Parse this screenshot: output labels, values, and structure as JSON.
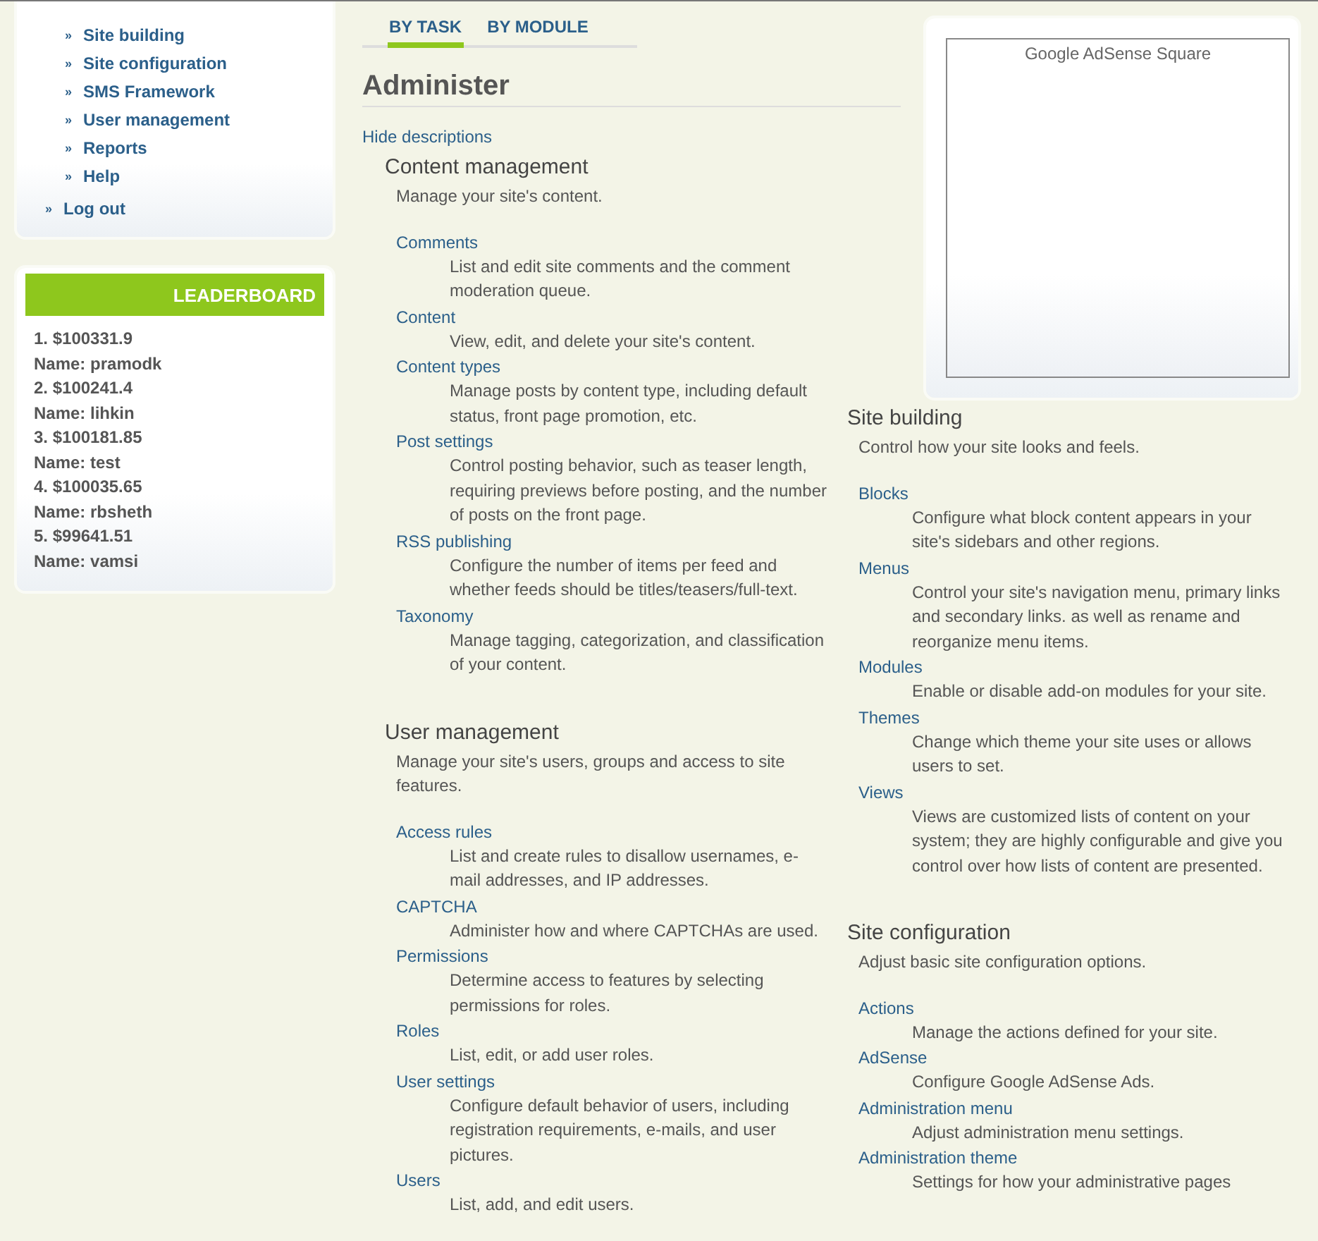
{
  "sidebar": {
    "nav_items": [
      {
        "marker": "»",
        "label": "Site building"
      },
      {
        "marker": "»",
        "label": "Site configuration"
      },
      {
        "marker": "»",
        "label": "SMS Framework"
      },
      {
        "marker": "»",
        "label": "User management"
      },
      {
        "marker": "»",
        "label": "Reports"
      },
      {
        "marker": "»",
        "label": "Help"
      }
    ],
    "logout": {
      "marker": "»",
      "label": "Log out"
    },
    "leaderboard": {
      "title": "LEADERBOARD",
      "entries": [
        {
          "amount": "1. $100331.9",
          "name": "Name: pramodk"
        },
        {
          "amount": "2. $100241.4",
          "name": "Name: lihkin"
        },
        {
          "amount": "3. $100181.85",
          "name": "Name: test"
        },
        {
          "amount": "4. $100035.65",
          "name": "Name: rbsheth"
        },
        {
          "amount": "5. $99641.51",
          "name": "Name: vamsi"
        }
      ]
    }
  },
  "tabs": [
    {
      "label": "BY TASK",
      "selected": true
    },
    {
      "label": "BY MODULE",
      "selected": false
    }
  ],
  "title": "Administer",
  "toggle_link": "Hide descriptions",
  "ad": {
    "label": "Google AdSense Square"
  },
  "columns": [
    [
      {
        "title": "Content management",
        "description": "Manage your site's content.",
        "items": [
          {
            "label": "Comments",
            "description": "List and edit site comments and the comment moderation queue."
          },
          {
            "label": "Content",
            "description": "View, edit, and delete your site's content."
          },
          {
            "label": "Content types",
            "description": "Manage posts by content type, including default status, front page promotion, etc."
          },
          {
            "label": "Post settings",
            "description": "Control posting behavior, such as teaser length, requiring previews before posting, and the number of posts on the front page."
          },
          {
            "label": "RSS publishing",
            "description": "Configure the number of items per feed and whether feeds should be titles/teasers/full-text."
          },
          {
            "label": "Taxonomy",
            "description": "Manage tagging, categorization, and classification of your content."
          }
        ]
      },
      {
        "title": "User management",
        "description": "Manage your site's users, groups and access to site features.",
        "items": [
          {
            "label": "Access rules",
            "description": "List and create rules to disallow usernames, e-mail addresses, and IP addresses."
          },
          {
            "label": "CAPTCHA",
            "description": "Administer how and where CAPTCHAs are used."
          },
          {
            "label": "Permissions",
            "description": "Determine access to features by selecting permissions for roles."
          },
          {
            "label": "Roles",
            "description": "List, edit, or add user roles."
          },
          {
            "label": "User settings",
            "description": "Configure default behavior of users, including registration requirements, e-mails, and user pictures."
          },
          {
            "label": "Users",
            "description": "List, add, and edit users."
          }
        ]
      }
    ],
    [
      {
        "title": "Site building",
        "description": "Control how your site looks and feels.",
        "items": [
          {
            "label": "Blocks",
            "description": "Configure what block content appears in your site's sidebars and other regions."
          },
          {
            "label": "Menus",
            "description": "Control your site's navigation menu, primary links and secondary links. as well as rename and reorganize menu items."
          },
          {
            "label": "Modules",
            "description": "Enable or disable add-on modules for your site."
          },
          {
            "label": "Themes",
            "description": "Change which theme your site uses or allows users to set."
          },
          {
            "label": "Views",
            "description": "Views are customized lists of content on your system; they are highly configurable and give you control over how lists of content are presented."
          }
        ]
      },
      {
        "title": "Site configuration",
        "description": "Adjust basic site configuration options.",
        "items": [
          {
            "label": "Actions",
            "description": "Manage the actions defined for your site."
          },
          {
            "label": "AdSense",
            "description": "Configure Google AdSense Ads."
          },
          {
            "label": "Administration menu",
            "description": "Adjust administration menu settings."
          },
          {
            "label": "Administration theme",
            "description": "Settings for how your administrative pages"
          }
        ]
      }
    ]
  ]
}
